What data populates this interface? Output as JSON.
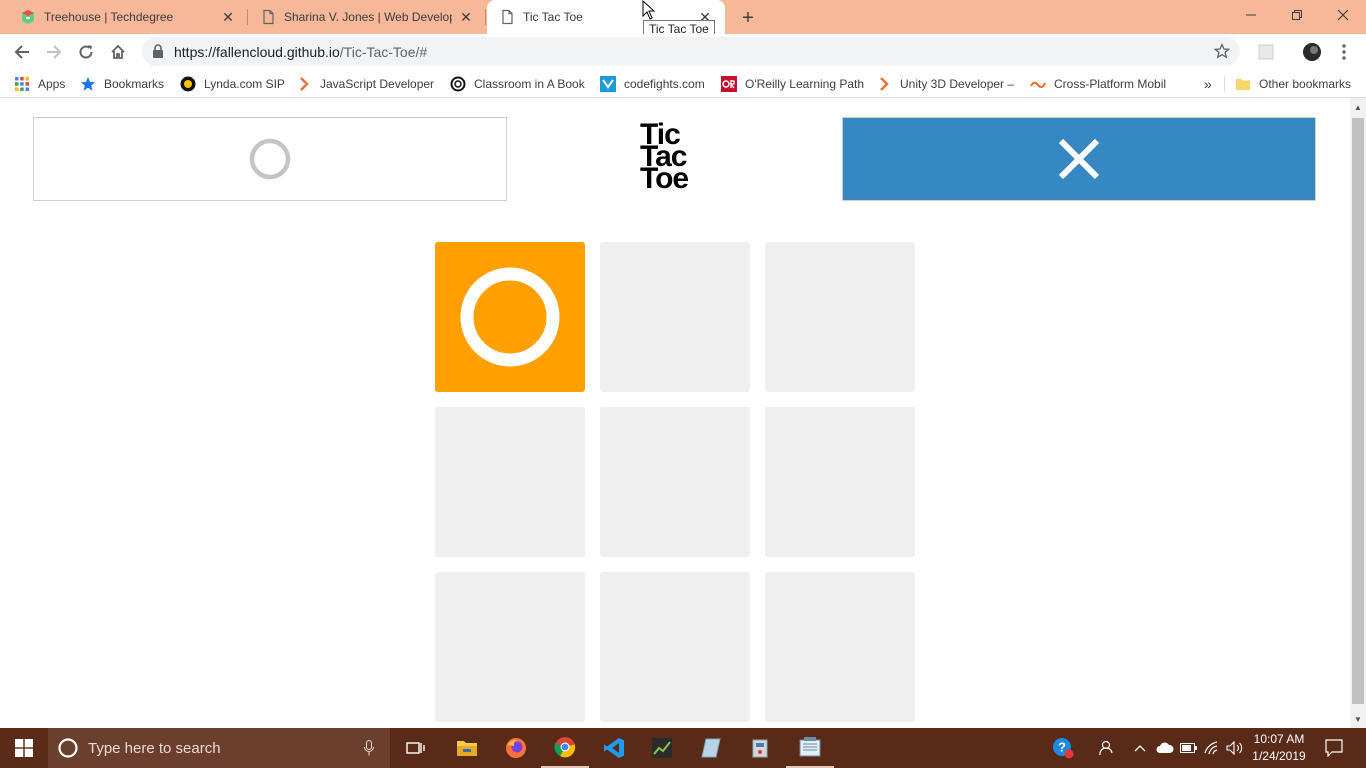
{
  "browser": {
    "tabs": [
      {
        "label": "Treehouse | Techdegree",
        "icon": "treehouse-icon",
        "active": false
      },
      {
        "label": "Sharina V. Jones | Web Developer",
        "icon": "page-icon",
        "active": false
      },
      {
        "label": "Tic Tac Toe",
        "icon": "page-icon",
        "active": true
      }
    ],
    "tooltip": "Tic Tac Toe",
    "url_host": "https://fallencloud.github.io",
    "url_path": "/Tic-Tac-Toe/#",
    "bookmarks": [
      {
        "label": "Apps",
        "icon": "apps-grid-icon"
      },
      {
        "label": "Bookmarks",
        "icon": "star-icon"
      },
      {
        "label": "Lynda.com SIP",
        "icon": "lynda-icon"
      },
      {
        "label": "JavaScript Developer",
        "icon": "treehouse-chevron-icon"
      },
      {
        "label": "Classroom in A Book",
        "icon": "classroom-icon"
      },
      {
        "label": "codefights.com",
        "icon": "codefights-icon"
      },
      {
        "label": "O'Reilly Learning Path",
        "icon": "oreilly-icon"
      },
      {
        "label": "Unity 3D Developer –",
        "icon": "treehouse-chevron-icon"
      },
      {
        "label": "Cross-Platform Mobil",
        "icon": "cross-platform-icon"
      }
    ],
    "other_bookmarks": "Other bookmarks",
    "overflow": "»"
  },
  "game": {
    "title_lines": [
      "Tic",
      "Tac",
      "Toe"
    ],
    "player1": {
      "symbol": "O",
      "active": false
    },
    "player2": {
      "symbol": "X",
      "active": true
    },
    "board": [
      "O",
      "",
      "",
      "",
      "",
      "",
      "",
      "",
      ""
    ],
    "colors": {
      "player_o": "#ffa000",
      "player_x": "#3688c3",
      "empty_box": "#efefef"
    }
  },
  "taskbar": {
    "search_placeholder": "Type here to search",
    "time": "10:07 AM",
    "date": "1/24/2019"
  }
}
